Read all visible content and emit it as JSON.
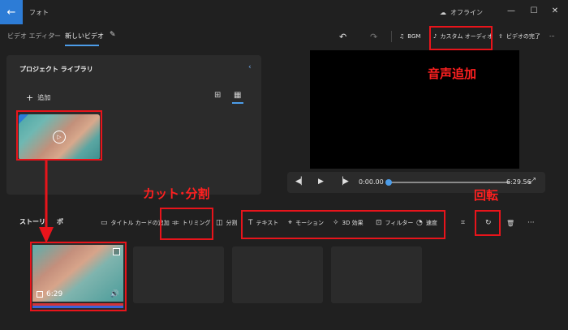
{
  "titlebar": {
    "app_title": "フォト",
    "back_icon": "←",
    "offline_label": "オフライン",
    "offline_icon": "☁",
    "minimize_icon": "—",
    "maximize_icon": "☐",
    "close_icon": "✕"
  },
  "header": {
    "breadcrumb_root": "ビデオ エディター",
    "breadcrumb_sep": "›",
    "breadcrumb_current": "新しいビデオ",
    "pencil_icon": "✎",
    "undo_icon": "↶",
    "redo_icon": "↷",
    "bgm_icon": "♫",
    "bgm_label": "BGM",
    "custom_audio_icon": "♪",
    "custom_audio_label": "カスタム オーディオ",
    "finish_icon": "⇪",
    "finish_label": "ビデオの完了",
    "more_icon": "···"
  },
  "library": {
    "title": "プロジェクト ライブラリ",
    "collapse_icon": "‹",
    "add_icon": "+",
    "add_label": "追加",
    "grid_large_icon": "⊞",
    "grid_small_icon": "▦",
    "play_icon": "▷"
  },
  "player": {
    "prev_icon": "◀▏",
    "play_icon": "▶",
    "next_icon": "▕▶",
    "time_start": "0:00.00",
    "time_end": "6:29.56",
    "progress": 0,
    "fullscreen_icon": "⤢"
  },
  "storyboard": {
    "label": "ストーリ",
    "label_tail": "ボ",
    "toolbar": [
      {
        "icon": "▭",
        "label": "タイトル カードの追加"
      },
      {
        "icon": "⟚",
        "label": "トリミング"
      },
      {
        "icon": "◫",
        "label": "分割"
      },
      {
        "icon": "T",
        "label": "テキスト"
      },
      {
        "icon": "⌖",
        "label": "モーション"
      },
      {
        "icon": "✧",
        "label": "3D 効果"
      },
      {
        "icon": "⊡",
        "label": "フィルター"
      },
      {
        "icon": "◔",
        "label": "速度"
      }
    ],
    "crop_icon": "⌗",
    "rotate_icon": "↻",
    "delete_icon": "🗑",
    "more_icon": "···",
    "clip": {
      "duration": "6:29",
      "volume_icon": "🔊"
    }
  },
  "annotations": {
    "audio_add": "音声追加",
    "cut_split": "カット･分割",
    "rotate": "回転",
    "colors": {
      "annotation": "#e8141b",
      "accent": "#2d7cd6"
    }
  }
}
